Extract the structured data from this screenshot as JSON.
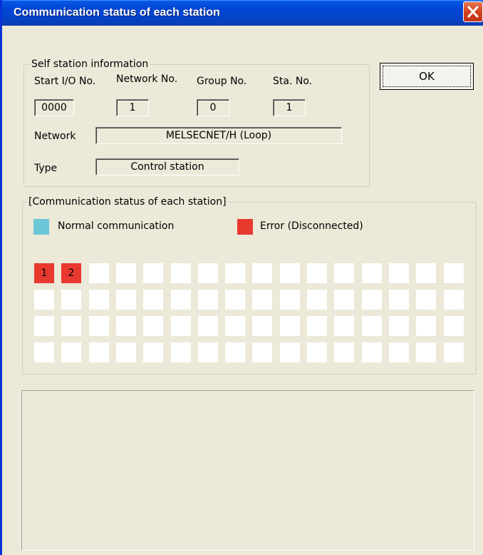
{
  "window": {
    "title": "Communication status of each station"
  },
  "self_station": {
    "legend": "Self station information",
    "start_io_label": "Start I/O No.",
    "network_no_label": "Network No.",
    "group_no_label": "Group No.",
    "sta_no_label": "Sta. No.",
    "start_io_value": "0000",
    "network_no_value": "1",
    "group_no_value": "0",
    "sta_no_value": "1",
    "network_label": "Network",
    "network_value": "MELSECNET/H (Loop)",
    "type_label": "Type",
    "type_value": "Control station"
  },
  "ok_button": {
    "label": "OK"
  },
  "comm_status": {
    "legend": "[Communication status of each station]",
    "normal_label": "Normal communication",
    "error_label": "Error (Disconnected)",
    "colors": {
      "normal": "#6cc8d8",
      "error": "#e8392f",
      "idle": "#ffffff"
    },
    "rows": 4,
    "columns": 16,
    "stations": [
      {
        "label": "1",
        "state": "error"
      },
      {
        "label": "2",
        "state": "error"
      }
    ]
  }
}
